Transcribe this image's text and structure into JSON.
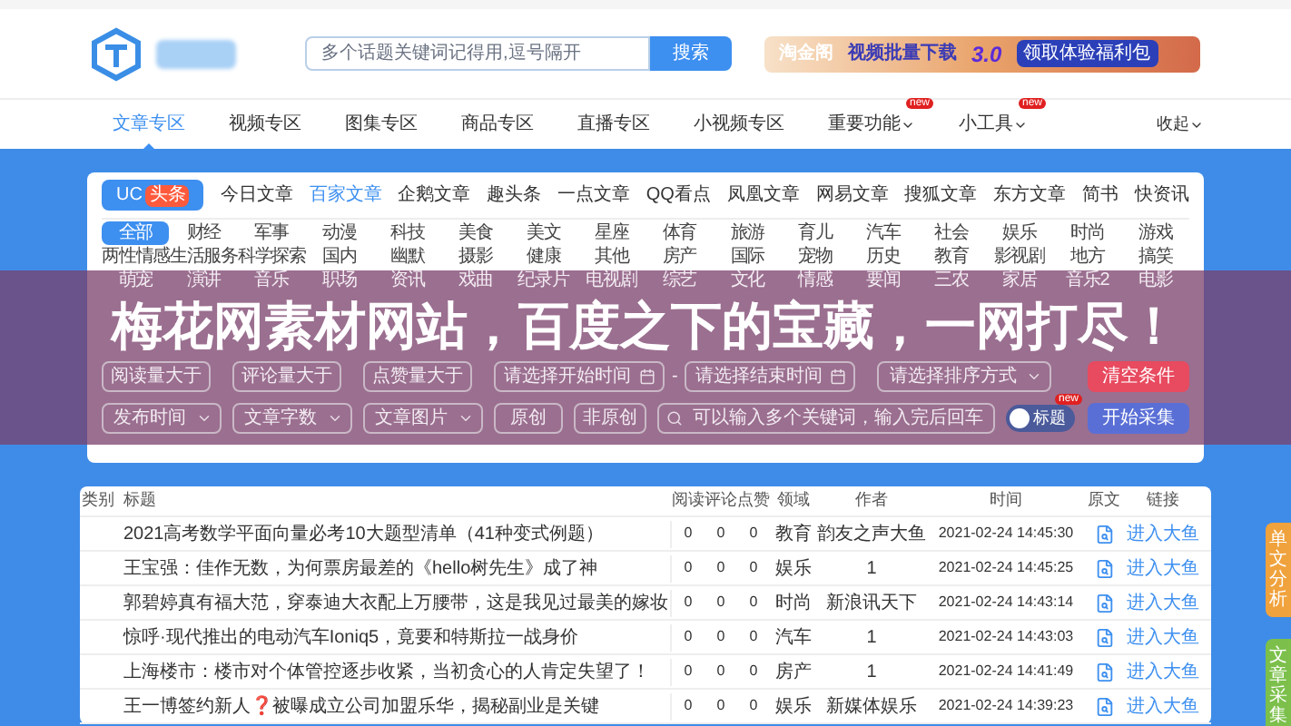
{
  "header": {
    "search": {
      "placeholder": "多个话题关键词记得用,逗号隔开",
      "button": "搜索"
    },
    "banner": {
      "brand": "淘金阁",
      "slogan": "视频批量下载",
      "version": "3.0",
      "cta": "领取体验福利包"
    }
  },
  "nav": {
    "items": [
      {
        "label": "文章专区",
        "selected": true,
        "dropdown": false
      },
      {
        "label": "视频专区",
        "selected": false,
        "dropdown": false
      },
      {
        "label": "图集专区",
        "selected": false,
        "dropdown": false
      },
      {
        "label": "商品专区",
        "selected": false,
        "dropdown": false
      },
      {
        "label": "直播专区",
        "selected": false,
        "dropdown": false
      },
      {
        "label": "小视频专区",
        "selected": false,
        "dropdown": false
      },
      {
        "label": "重要功能",
        "selected": false,
        "badge": "new",
        "dropdown": true
      },
      {
        "label": "小工具",
        "selected": false,
        "badge": "new",
        "dropdown": true
      }
    ],
    "collapse": "收起"
  },
  "source_tabs": [
    {
      "kind": "pill",
      "label": "UC",
      "tag": "头条",
      "selected": false
    },
    {
      "kind": "text",
      "label": "今日文章",
      "selected": false
    },
    {
      "kind": "text",
      "label": "百家文章",
      "selected": true
    },
    {
      "kind": "text",
      "label": "企鹅文章",
      "selected": false
    },
    {
      "kind": "text",
      "label": "趣头条",
      "selected": false
    },
    {
      "kind": "text",
      "label": "一点文章",
      "selected": false
    },
    {
      "kind": "text",
      "label": "QQ看点",
      "selected": false
    },
    {
      "kind": "text",
      "label": "凤凰文章",
      "selected": false
    },
    {
      "kind": "text",
      "label": "网易文章",
      "selected": false
    },
    {
      "kind": "text",
      "label": "搜狐文章",
      "selected": false
    },
    {
      "kind": "text",
      "label": "东方文章",
      "selected": false
    },
    {
      "kind": "text",
      "label": "简书",
      "selected": false
    },
    {
      "kind": "text",
      "label": "快资讯",
      "selected": false
    }
  ],
  "categories": [
    {
      "label": "全部",
      "selected": true
    },
    {
      "label": "财经",
      "selected": false
    },
    {
      "label": "军事",
      "selected": false
    },
    {
      "label": "动漫",
      "selected": false
    },
    {
      "label": "科技",
      "selected": false
    },
    {
      "label": "美食",
      "selected": false
    },
    {
      "label": "美文",
      "selected": false
    },
    {
      "label": "星座",
      "selected": false
    },
    {
      "label": "体育",
      "selected": false
    },
    {
      "label": "旅游",
      "selected": false
    },
    {
      "label": "育儿",
      "selected": false
    },
    {
      "label": "汽车",
      "selected": false
    },
    {
      "label": "社会",
      "selected": false
    },
    {
      "label": "娱乐",
      "selected": false
    },
    {
      "label": "时尚",
      "selected": false
    },
    {
      "label": "游戏",
      "selected": false
    },
    {
      "label": "两性情感",
      "selected": false
    },
    {
      "label": "生活服务",
      "selected": false
    },
    {
      "label": "科学探索",
      "selected": false
    },
    {
      "label": "国内",
      "selected": false
    },
    {
      "label": "幽默",
      "selected": false
    },
    {
      "label": "摄影",
      "selected": false
    },
    {
      "label": "健康",
      "selected": false
    },
    {
      "label": "其他",
      "selected": false
    },
    {
      "label": "房产",
      "selected": false
    },
    {
      "label": "国际",
      "selected": false
    },
    {
      "label": "宠物",
      "selected": false
    },
    {
      "label": "历史",
      "selected": false
    },
    {
      "label": "教育",
      "selected": false
    },
    {
      "label": "影视剧",
      "selected": false
    },
    {
      "label": "地方",
      "selected": false
    },
    {
      "label": "搞笑",
      "selected": false
    },
    {
      "label": "萌宠",
      "selected": false
    },
    {
      "label": "演讲",
      "selected": false
    },
    {
      "label": "音乐",
      "selected": false
    },
    {
      "label": "职场",
      "selected": false
    },
    {
      "label": "资讯",
      "selected": false
    },
    {
      "label": "戏曲",
      "selected": false
    },
    {
      "label": "纪录片",
      "selected": false
    },
    {
      "label": "电视剧",
      "selected": false
    },
    {
      "label": "综艺",
      "selected": false
    },
    {
      "label": "文化",
      "selected": false
    },
    {
      "label": "情感",
      "selected": false
    },
    {
      "label": "要闻",
      "selected": false
    },
    {
      "label": "三农",
      "selected": false
    },
    {
      "label": "家居",
      "selected": false
    },
    {
      "label": "音乐2",
      "selected": false
    },
    {
      "label": "电影",
      "selected": false
    }
  ],
  "filters": {
    "min_reads": {
      "placeholder": "阅读量大于"
    },
    "min_comments": {
      "placeholder": "评论量大于"
    },
    "min_likes": {
      "placeholder": "点赞量大于"
    },
    "start_time": {
      "placeholder": "请选择开始时间"
    },
    "range_separator": "-",
    "end_time": {
      "placeholder": "请选择结束时间"
    },
    "sort": {
      "placeholder": "请选择排序方式"
    },
    "clear_button": "清空条件",
    "publish_time": {
      "placeholder": "发布时间"
    },
    "word_count": {
      "placeholder": "文章字数"
    },
    "images": {
      "placeholder": "文章图片"
    },
    "original_button": "原创",
    "non_original_button": "非原创",
    "keyword": {
      "placeholder": "可以输入多个关键词，输入完后回车"
    },
    "title_toggle": {
      "label": "标题",
      "on": false,
      "badge": "new"
    },
    "start_button": "开始采集"
  },
  "overlay_title": "梅花网素材网站，百度之下的宝藏，一网打尽！",
  "table": {
    "columns": [
      "类别",
      "标题",
      "阅读",
      "评论",
      "点赞",
      "领域",
      "作者",
      "时间",
      "原文",
      "链接"
    ],
    "rows": [
      {
        "title": "2021高考数学平面向量必考10大题型清单（41种变式例题）",
        "reads": "0",
        "comments": "0",
        "likes": "0",
        "field": "教育",
        "author": "韵友之声大鱼",
        "time": "2021-02-24 14:45:30",
        "link": "进入大鱼"
      },
      {
        "title": "王宝强：佳作无数，为何票房最差的《hello树先生》成了神",
        "reads": "0",
        "comments": "0",
        "likes": "0",
        "field": "娱乐",
        "author": "1",
        "time": "2021-02-24 14:45:25",
        "link": "进入大鱼"
      },
      {
        "title": "郭碧婷真有福大范，穿泰迪大衣配上万腰带，这是我见过最美的嫁妆",
        "reads": "0",
        "comments": "0",
        "likes": "0",
        "field": "时尚",
        "author": "新浪讯天下",
        "time": "2021-02-24 14:43:14",
        "link": "进入大鱼"
      },
      {
        "title": "惊呼·现代推出的电动汽车Ioniq5，竟要和特斯拉一战身价",
        "reads": "0",
        "comments": "0",
        "likes": "0",
        "field": "汽车",
        "author": "1",
        "time": "2021-02-24 14:43:03",
        "link": "进入大鱼"
      },
      {
        "title": "上海楼市：楼市对个体管控逐步收紧，当初贪心的人肯定失望了！",
        "reads": "0",
        "comments": "0",
        "likes": "0",
        "field": "房产",
        "author": "1",
        "time": "2021-02-24 14:41:49",
        "link": "进入大鱼"
      },
      {
        "title": "王一博签约新人❓被曝成立公司加盟乐华，揭秘副业是关键",
        "reads": "0",
        "comments": "0",
        "likes": "0",
        "field": "娱乐",
        "author": "新媒体娱乐",
        "time": "2021-02-24 14:39:23",
        "link": "进入大鱼"
      }
    ]
  },
  "side_tabs": [
    {
      "label": "单文分析",
      "color": "#f0a23c"
    },
    {
      "label": "文章采集",
      "color": "#7cc04b"
    }
  ]
}
